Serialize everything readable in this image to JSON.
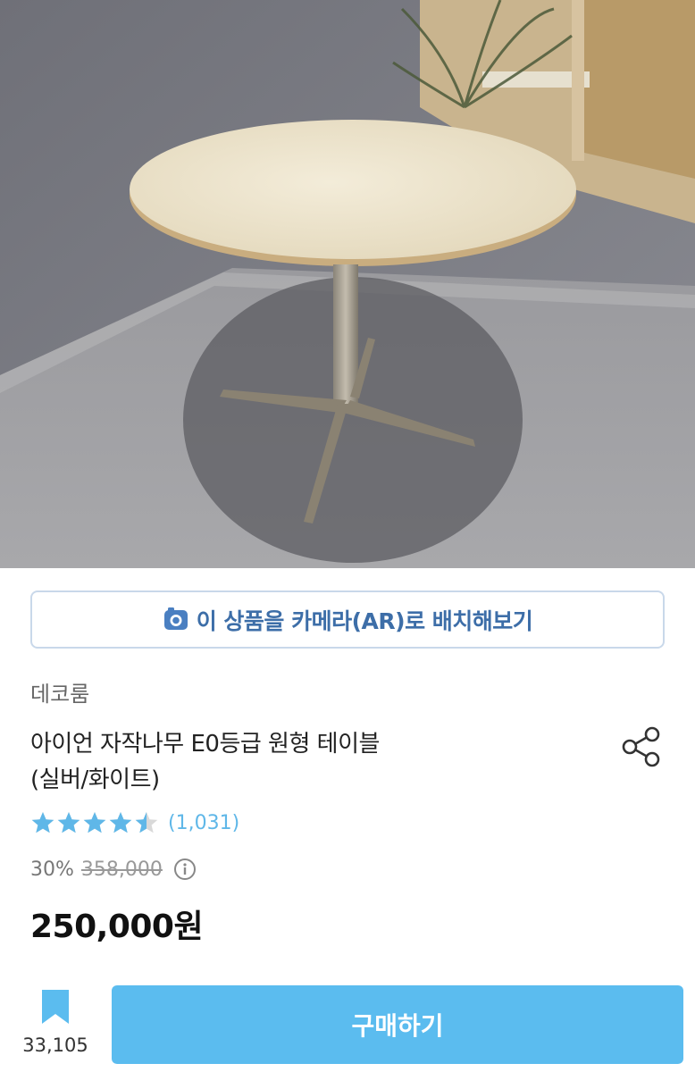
{
  "product_image": {
    "alt_icon": "table-photo"
  },
  "ar": {
    "icon": "camera-icon",
    "label": "이 상품을 카메라(AR)로 배치해보기"
  },
  "product": {
    "brand": "데코룸",
    "title_line1": "아이언 자작나무 E0등급 원형 테이블",
    "title_line2": "(실버/화이트)",
    "share_icon": "share-icon"
  },
  "rating": {
    "stars": 4.5,
    "review_count": "(1,031)",
    "star_color": "#5fb7e8"
  },
  "pricing": {
    "discount_rate": "30%",
    "original_price": "358,000",
    "info_icon": "info-icon",
    "sale_price": "250,000원"
  },
  "bottom_bar": {
    "bookmark_icon": "bookmark-icon",
    "bookmark_count": "33,105",
    "buy_label": "구매하기",
    "accent": "#5bbcef"
  }
}
